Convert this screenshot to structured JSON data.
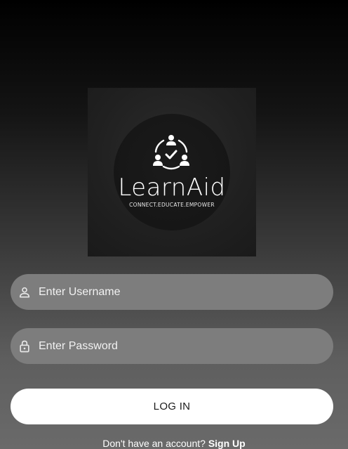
{
  "logo": {
    "name": "LearnAid",
    "tagline": "CONNECT.EDUCATE.EMPOWER",
    "icon": "people-check-icon"
  },
  "form": {
    "username_placeholder": "Enter Username",
    "username_icon": "person-icon",
    "password_placeholder": "Enter Password",
    "password_icon": "lock-icon",
    "login_label": "LOG IN"
  },
  "signup": {
    "prompt": "Don't have an account?",
    "link_label": "Sign Up"
  }
}
